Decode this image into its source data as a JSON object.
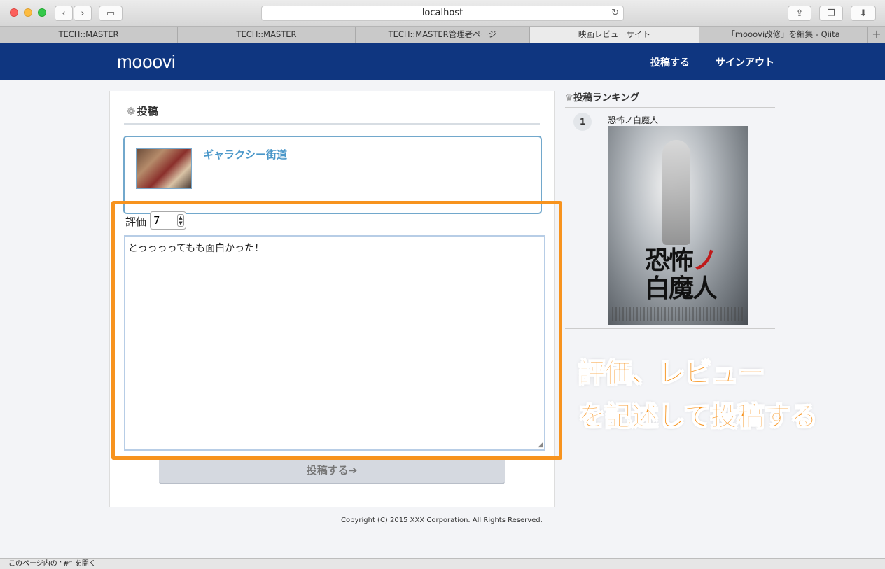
{
  "browser": {
    "address": "localhost",
    "tabs": [
      {
        "label": "TECH::MASTER",
        "active": false
      },
      {
        "label": "TECH::MASTER",
        "active": false
      },
      {
        "label": "TECH::MASTER管理者ページ",
        "active": false
      },
      {
        "label": "映画レビューサイト",
        "active": true
      },
      {
        "label": "「mooovi改修」を編集 - Qiita",
        "active": false
      }
    ],
    "status_text": "このページ内の “#” を開く"
  },
  "site": {
    "brand": "mooovi",
    "nav": {
      "post": "投稿する",
      "signout": "サインアウト"
    }
  },
  "main": {
    "heading": "投稿",
    "movie": {
      "title": "ギャラクシー街道"
    },
    "rating_label": "評価",
    "rating_value": "7",
    "review_text": "とっっっってもも面白かった！",
    "submit_label": "投稿する➔",
    "copyright": "Copyright (C) 2015 XXX Corporation. All Rights Reserved."
  },
  "ranking": {
    "heading": "投稿ランキング",
    "items": [
      {
        "rank": "1",
        "title": "恐怖ノ白魔人",
        "poster_text": "恐怖ノ白魔人"
      }
    ]
  },
  "annotation": {
    "line1": "評価、レビュー",
    "line2": "を記述して投稿する",
    "color": "#f7931e"
  }
}
